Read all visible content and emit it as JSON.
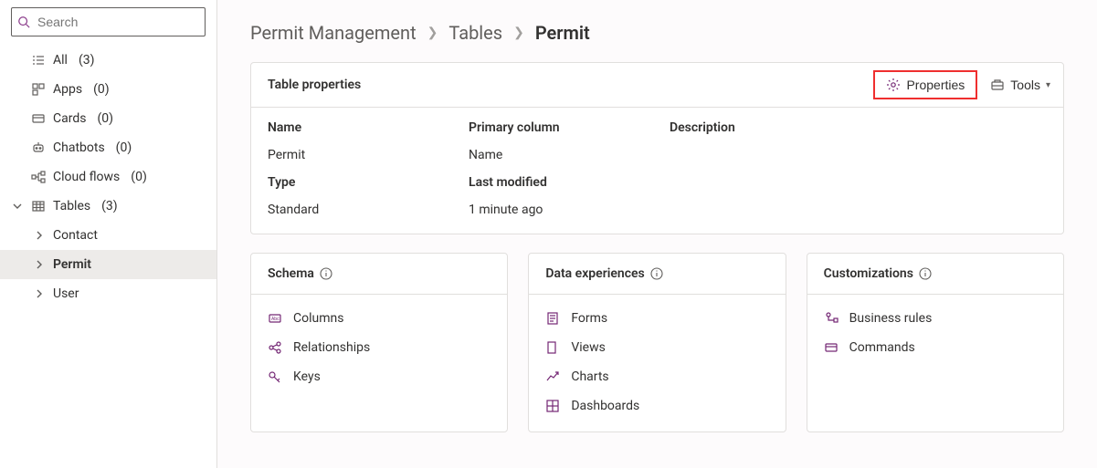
{
  "search": {
    "placeholder": "Search"
  },
  "sidebar": {
    "items": [
      {
        "label": "All",
        "count": "(3)"
      },
      {
        "label": "Apps",
        "count": "(0)"
      },
      {
        "label": "Cards",
        "count": "(0)"
      },
      {
        "label": "Chatbots",
        "count": "(0)"
      },
      {
        "label": "Cloud flows",
        "count": "(0)"
      },
      {
        "label": "Tables",
        "count": "(3)"
      }
    ],
    "tables_children": [
      {
        "label": "Contact"
      },
      {
        "label": "Permit"
      },
      {
        "label": "User"
      }
    ]
  },
  "breadcrumb": {
    "a": "Permit Management",
    "b": "Tables",
    "c": "Permit"
  },
  "properties_card": {
    "title": "Table properties",
    "actions": {
      "properties": "Properties",
      "tools": "Tools"
    },
    "rows": {
      "name_label": "Name",
      "name_value": "Permit",
      "primary_label": "Primary column",
      "primary_value": "Name",
      "description_label": "Description",
      "description_value": "",
      "type_label": "Type",
      "type_value": "Standard",
      "modified_label": "Last modified",
      "modified_value": "1 minute ago"
    }
  },
  "cards": {
    "schema": {
      "title": "Schema",
      "items": [
        {
          "label": "Columns"
        },
        {
          "label": "Relationships"
        },
        {
          "label": "Keys"
        }
      ]
    },
    "data_experiences": {
      "title": "Data experiences",
      "items": [
        {
          "label": "Forms"
        },
        {
          "label": "Views"
        },
        {
          "label": "Charts"
        },
        {
          "label": "Dashboards"
        }
      ]
    },
    "customizations": {
      "title": "Customizations",
      "items": [
        {
          "label": "Business rules"
        },
        {
          "label": "Commands"
        }
      ]
    }
  }
}
